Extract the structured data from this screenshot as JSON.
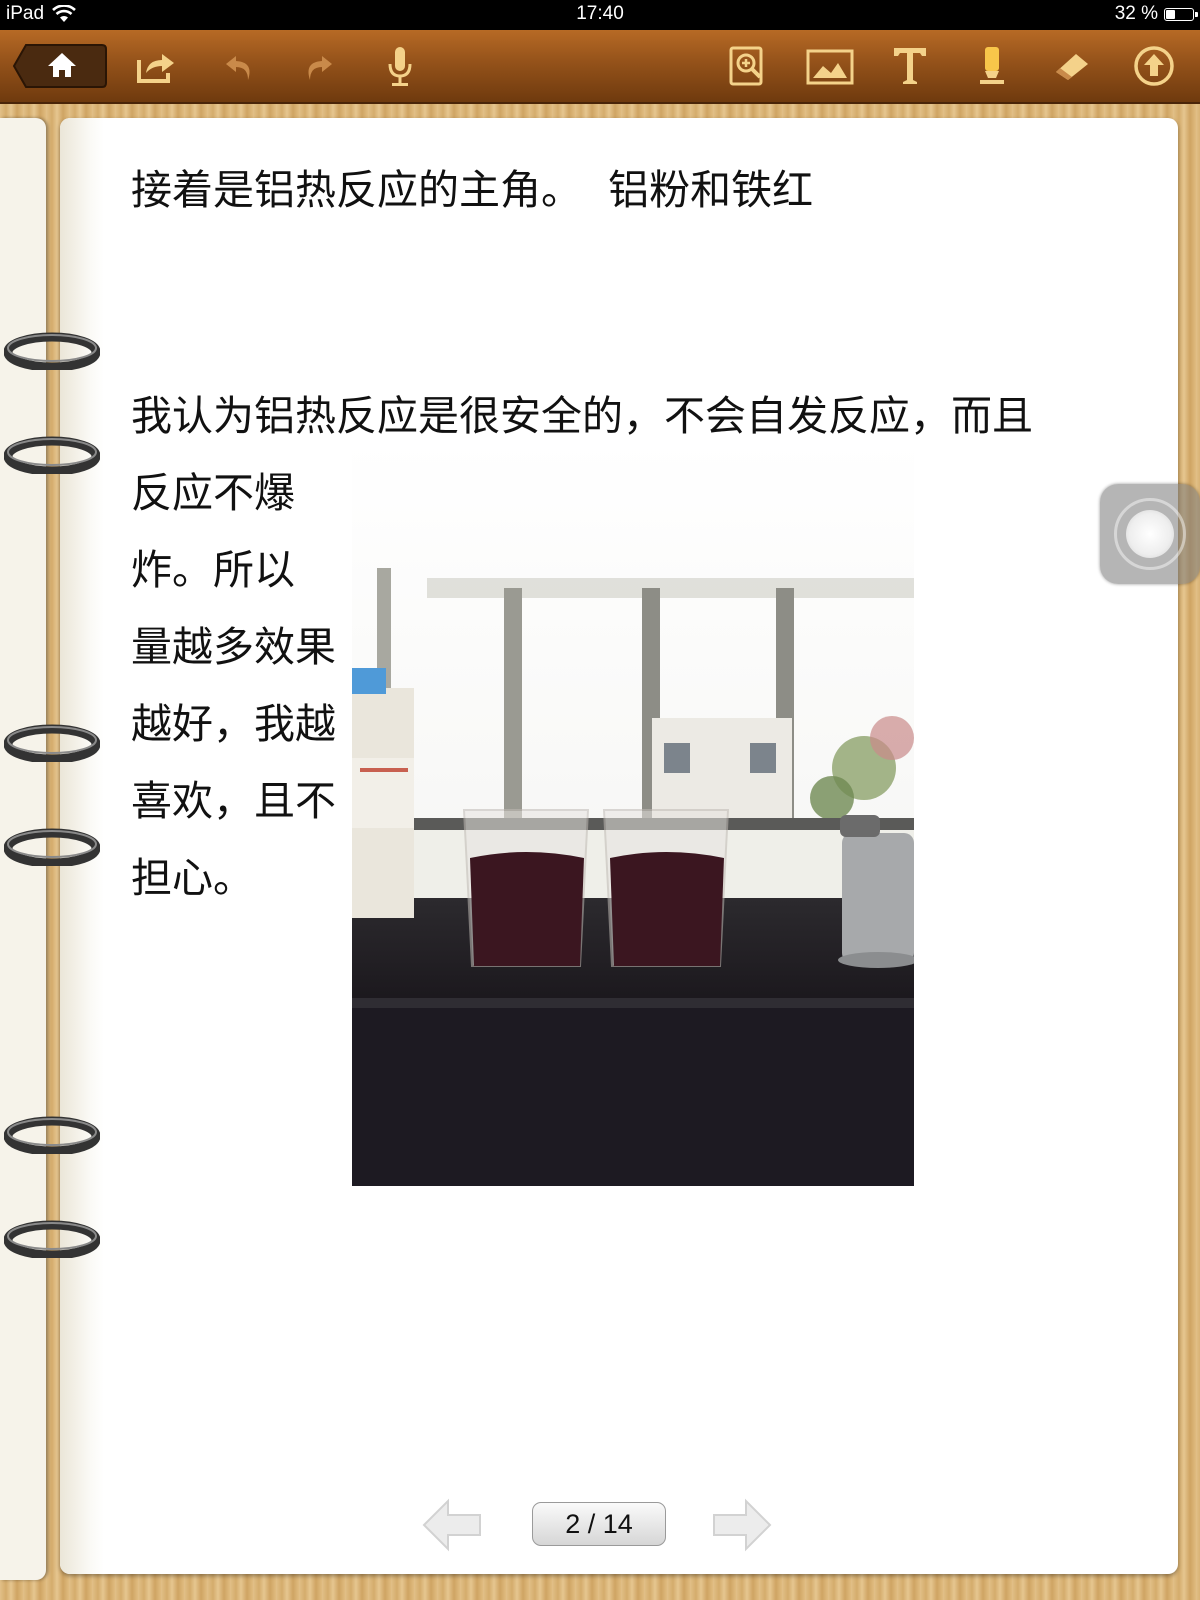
{
  "status_bar": {
    "device": "iPad",
    "time": "17:40",
    "battery_percent": "32 %",
    "battery_level": 0.32
  },
  "toolbar": {
    "items": [
      "home-icon",
      "share-icon",
      "undo-icon",
      "redo-icon",
      "microphone-icon",
      "zoom-icon",
      "image-icon",
      "text-icon",
      "highlighter-icon",
      "eraser-icon",
      "upload-icon"
    ]
  },
  "note": {
    "line1": "接着是铝热反应的主角。  铝粉和铁红",
    "para2_lines": [
      "我认为铝热反应是很安全的，不会自发反应，而且",
      "反应不爆",
      "炸。所以",
      "量越多效果",
      "越好，我越",
      "喜欢，且不",
      "担心。"
    ]
  },
  "pager": {
    "label": "2 / 14"
  },
  "colors": {
    "toolbar": "#94521a",
    "wood": "#d9b582",
    "page": "#ffffff"
  }
}
